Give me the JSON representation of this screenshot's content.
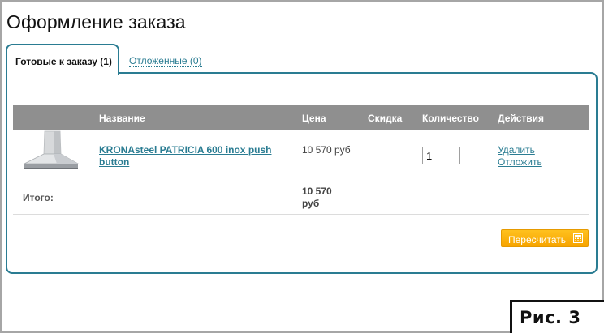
{
  "page": {
    "title": "Оформление заказа"
  },
  "tabs": [
    {
      "label": "Готовые к заказу (1)",
      "active": true
    },
    {
      "label": "Отложенные (0)",
      "active": false
    }
  ],
  "table": {
    "columns": [
      "Название",
      "Цена",
      "Скидка",
      "Количество",
      "Действия"
    ],
    "rows": [
      {
        "name": "KRONAsteel PATRICIA 600 inox push button",
        "price": "10 570 руб",
        "discount": "",
        "quantity": "1",
        "actions": [
          "Удалить",
          "Отложить"
        ]
      }
    ],
    "total_label": "Итого:",
    "total_value": "10 570 руб"
  },
  "buttons": {
    "recalculate": "Пересчитать"
  },
  "figure_label": "Рис. 3",
  "colors": {
    "accent": "#2a7c92",
    "header_bg": "#8f8f8f",
    "button_orange": "#f7a400"
  },
  "icons": {
    "recalculate": "calculator-icon"
  }
}
